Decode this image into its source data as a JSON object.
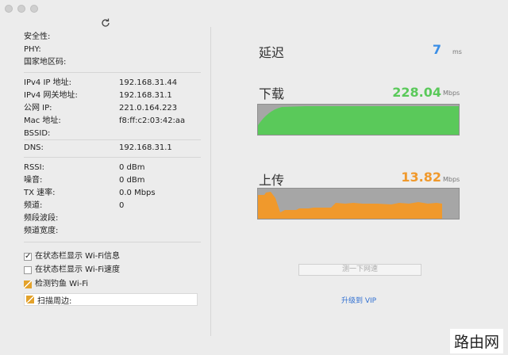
{
  "info": {
    "group1": [
      {
        "label": "安全性:",
        "value": ""
      },
      {
        "label": "PHY:",
        "value": ""
      },
      {
        "label": "国家地区码:",
        "value": ""
      }
    ],
    "group2": [
      {
        "label": "IPv4 IP 地址:",
        "value": "192.168.31.44"
      },
      {
        "label": "IPv4 网关地址:",
        "value": "192.168.31.1"
      },
      {
        "label": "公网 IP:",
        "value": "221.0.164.223"
      },
      {
        "label": "Mac 地址:",
        "value": "f8:ff:c2:03:42:aa"
      },
      {
        "label": "BSSID:",
        "value": ""
      }
    ],
    "group3": [
      {
        "label": "DNS:",
        "value": "192.168.31.1"
      }
    ],
    "group4": [
      {
        "label": "RSSI:",
        "value": "0 dBm"
      },
      {
        "label": "噪音:",
        "value": "0 dBm"
      },
      {
        "label": "TX 速率:",
        "value": "0.0 Mbps"
      },
      {
        "label": "频道:",
        "value": "0"
      },
      {
        "label": "频段波段:",
        "value": ""
      },
      {
        "label": "频道宽度:",
        "value": ""
      }
    ]
  },
  "options": {
    "show_wifi_info": {
      "label": "在状态栏显示 Wi-Fi信息",
      "checked": true
    },
    "show_wifi_speed": {
      "label": "在状态栏显示 Wi-Fi速度",
      "checked": false
    },
    "detect_phishing": {
      "label": "检测钓鱼 Wi-Fi"
    },
    "scan_nearby": {
      "label": "扫描周边:"
    }
  },
  "latency": {
    "label": "延迟",
    "value": "7",
    "unit": "ms"
  },
  "download": {
    "label": "下载",
    "value": "228.04",
    "unit": "Mbps",
    "color": "#5ac95a"
  },
  "upload": {
    "label": "上传",
    "value": "13.82",
    "unit": "Mbps",
    "color": "#f0992c"
  },
  "buttons": {
    "speed_test": "测一下网速",
    "upgrade": "升级到 VIP"
  },
  "watermark": "路由网"
}
